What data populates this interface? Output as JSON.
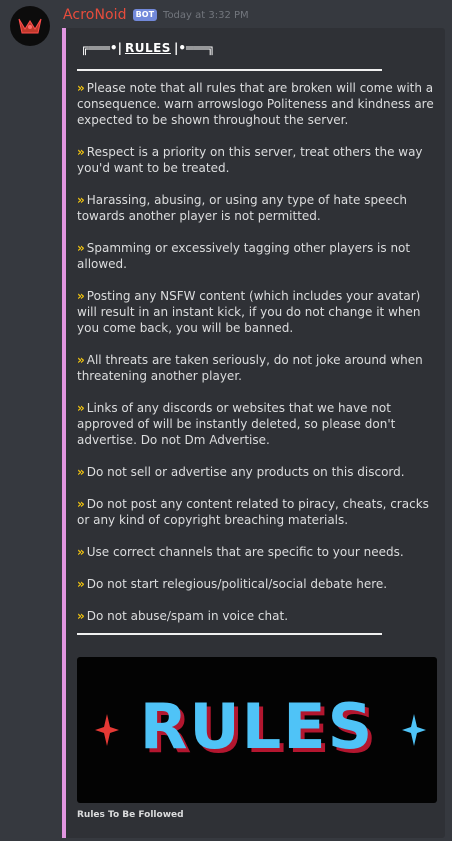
{
  "message": {
    "author": "AcroNoid",
    "bot_tag": "BOT",
    "timestamp": "Today at 3:32 PM"
  },
  "embed": {
    "accent_color": "#e196e0",
    "title": {
      "left_deco": "╔═══•|",
      "word": "RULES",
      "right_deco": "|•═══╗"
    },
    "rules": [
      {
        "text": "Please note that all rules that are broken will come with a consequence. warn arrowslogo Politeness and kindness are expected to be shown throughout the server."
      },
      {
        "text": "Respect is a priority on this server, treat others the way you'd want to be treated."
      },
      {
        "text": "Harassing, abusing, or using any type of hate speech towards another player is not permitted."
      },
      {
        "text": "Spamming or excessively tagging other players is not allowed."
      },
      {
        "text": "Posting any NSFW content (which includes your avatar) will result in an instant kick, if you do not change it when you come back, you will be banned."
      },
      {
        "text": "All threats are taken seriously, do not joke around when threatening another player."
      },
      {
        "text": "Links of any discords or websites that we have not approved of will be instantly deleted, so please don't advertise. Do not Dm Advertise."
      },
      {
        "text": "Do not sell or advertise any products on this discord."
      },
      {
        "text": "Do not post any content related to piracy, cheats, cracks or any kind of copyright breaching materials."
      },
      {
        "text": "Use correct channels that are specific to your needs."
      },
      {
        "text": "Do not start relegious/political/social debate here."
      },
      {
        "text": "Do not abuse/spam in voice chat."
      }
    ],
    "bullet_glyph": "»",
    "bullet_color": "#f1c40f",
    "image": {
      "text": "RULES",
      "text_color": "#4fc3f7",
      "left_sparkle_color": "#e53935",
      "right_sparkle_color": "#4fc3f7"
    },
    "image_caption": "Rules To Be Followed"
  },
  "colors": {
    "background": "#36393f",
    "embed_background": "#2f3136",
    "username": "#e74c3c",
    "bot_tag": "#7289da"
  },
  "icons": {
    "avatar": "red-crown-logo-avatar",
    "bullet": "double-chevron-right-icon"
  }
}
